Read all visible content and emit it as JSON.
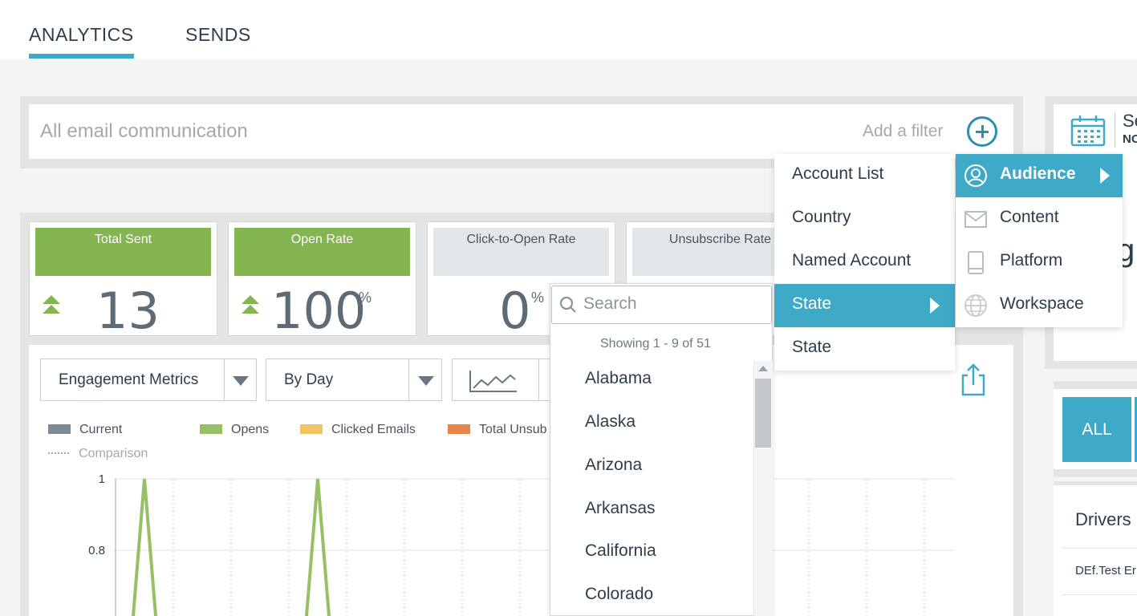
{
  "tabs": [
    {
      "label": "ANALYTICS",
      "active": true
    },
    {
      "label": "SENDS",
      "active": false
    }
  ],
  "filter_bar": {
    "scope_text": "All email communication",
    "add_filter_label": "Add a filter"
  },
  "date_panel": {
    "label_fragment": "Se",
    "sub_fragment": "NO"
  },
  "right_column": {
    "heading_fragment": "gh",
    "all_button": "ALL",
    "drivers_label": "Drivers",
    "first_row_fragment": "DEf.Test Er"
  },
  "kpis": [
    {
      "label": "Total Sent",
      "value": "13",
      "unit": "",
      "trend": "up",
      "highlight": true
    },
    {
      "label": "Open Rate",
      "value": "100",
      "unit": "%",
      "trend": "up",
      "highlight": true
    },
    {
      "label": "Click-to-Open Rate",
      "value": "0",
      "unit": "%",
      "trend": "none",
      "highlight": false
    },
    {
      "label": "Unsubscribe Rate",
      "value": "",
      "unit": "",
      "trend": "none",
      "highlight": false
    }
  ],
  "chart_controls": {
    "metric_select": "Engagement Metrics",
    "period_select": "By Day",
    "chart_type_icon": "line-chart-icon"
  },
  "legend": [
    {
      "name": "Current",
      "color": "#7d8a96"
    },
    {
      "name": "Opens",
      "color": "#97bf64"
    },
    {
      "name": "Clicked Emails",
      "color": "#f0c466"
    },
    {
      "name": "Total Unsub",
      "color": "#e8854a"
    }
  ],
  "comparison_label": "Comparison",
  "chart_data": {
    "type": "line",
    "y_ticks": [
      "1",
      "0.8"
    ],
    "ylim": [
      0,
      1
    ],
    "series": [
      {
        "name": "Opens",
        "color": "#97bf64",
        "spike_columns": [
          1,
          7
        ],
        "values_at_spikes": [
          1,
          1
        ]
      }
    ]
  },
  "state_dropdown": {
    "search_placeholder": "Search",
    "showing_text": "Showing 1 - 9 of 51",
    "states": [
      "Alabama",
      "Alaska",
      "Arizona",
      "Arkansas",
      "California",
      "Colorado"
    ]
  },
  "audience_menu": {
    "items": [
      {
        "label": "Account List",
        "active": false,
        "has_submenu": false
      },
      {
        "label": "Country",
        "active": false,
        "has_submenu": false
      },
      {
        "label": "Named Account",
        "active": false,
        "has_submenu": false
      },
      {
        "label": "State",
        "active": true,
        "has_submenu": true
      },
      {
        "label": "State",
        "active": false,
        "has_submenu": false
      }
    ]
  },
  "filter_categories": {
    "items": [
      {
        "label": "Audience",
        "icon": "person-icon",
        "active": true
      },
      {
        "label": "Content",
        "icon": "envelope-icon",
        "active": false
      },
      {
        "label": "Platform",
        "icon": "tablet-icon",
        "active": false
      },
      {
        "label": "Workspace",
        "icon": "globe-icon",
        "active": false
      }
    ]
  },
  "colors": {
    "accent": "#3eaac8",
    "kpi_green": "#84b550"
  }
}
